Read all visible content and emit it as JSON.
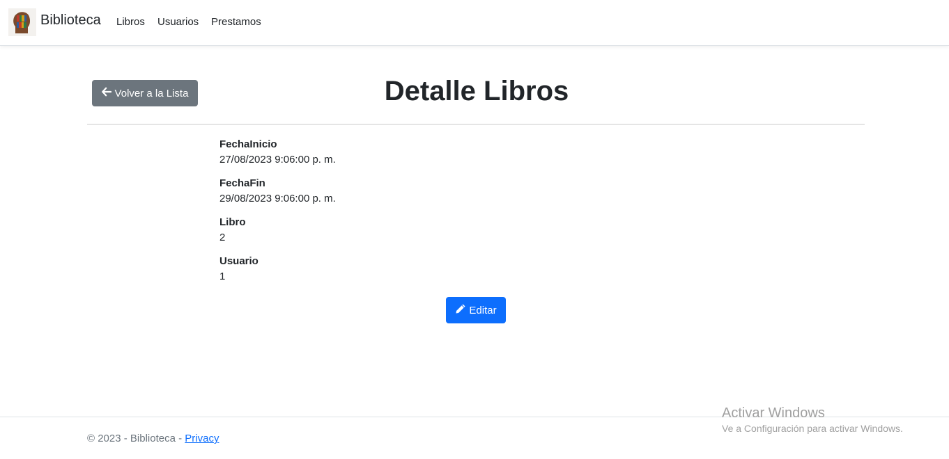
{
  "navbar": {
    "brand": "Biblioteca",
    "links": [
      "Libros",
      "Usuarios",
      "Prestamos"
    ]
  },
  "back_button": {
    "label": "Volver a la Lista"
  },
  "page_title": "Detalle Libros",
  "details": [
    {
      "label": "FechaInicio",
      "value": "27/08/2023 9:06:00 p. m."
    },
    {
      "label": "FechaFin",
      "value": "29/08/2023 9:06:00 p. m."
    },
    {
      "label": "Libro",
      "value": "2"
    },
    {
      "label": "Usuario",
      "value": "1"
    }
  ],
  "edit_button": {
    "label": "Editar"
  },
  "footer": {
    "text": "© 2023 - Biblioteca - ",
    "link": "Privacy"
  },
  "watermark": {
    "title": "Activar Windows",
    "subtitle": "Ve a Configuración para activar Windows."
  },
  "colors": {
    "primary": "#0d6efd",
    "secondary": "#6c757d"
  }
}
